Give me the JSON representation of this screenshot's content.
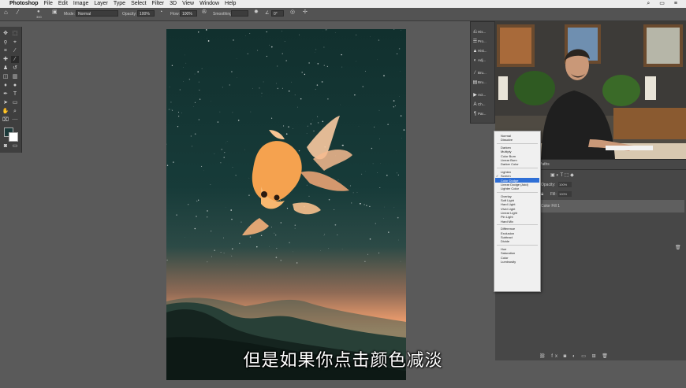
{
  "menubar": {
    "app_name": "Photoshop",
    "items": [
      "File",
      "Edit",
      "Image",
      "Layer",
      "Type",
      "Select",
      "Filter",
      "3D",
      "View",
      "Window",
      "Help"
    ]
  },
  "options_bar": {
    "brush_size": "300",
    "mode_label": "Mode:",
    "mode_value": "Normal",
    "opacity_label": "Opacity:",
    "opacity_value": "100%",
    "flow_label": "Flow:",
    "flow_value": "100%",
    "smoothing_label": "Smoothing:",
    "angle_value": "0°"
  },
  "mini_panels": [
    {
      "label": "His...",
      "icon": "history-icon"
    },
    {
      "label": "Pro...",
      "icon": "properties-icon"
    },
    {
      "label": "Hist...",
      "icon": "histogram-icon"
    },
    {
      "label": "Adj...",
      "icon": "adjustments-icon"
    },
    {
      "label": "Bru...",
      "icon": "brush-icon"
    },
    {
      "label": "Bru...",
      "icon": "brush-settings-icon"
    },
    {
      "label": "Act...",
      "icon": "actions-icon"
    },
    {
      "label": "Ch...",
      "icon": "character-icon"
    },
    {
      "label": "Par...",
      "icon": "paragraph-icon"
    }
  ],
  "layers_panel": {
    "tab_paths": "Paths",
    "opacity_label": "Opacity:",
    "opacity_value": "100%",
    "fill_label": "Fill:",
    "fill_value": "100%",
    "layer_name": "Color Fill 1"
  },
  "blend_dropdown": {
    "selected": "Screen",
    "highlighted": "Color Dodge",
    "groups": [
      [
        "Normal",
        "Dissolve"
      ],
      [
        "Darken",
        "Multiply",
        "Color Burn",
        "Linear Burn",
        "Darker Color"
      ],
      [
        "Lighten",
        "Screen",
        "Color Dodge",
        "Linear Dodge (Add)",
        "Lighter Color"
      ],
      [
        "Overlay",
        "Soft Light",
        "Hard Light",
        "Vivid Light",
        "Linear Light",
        "Pin Light",
        "Hard Mix"
      ],
      [
        "Difference",
        "Exclusion",
        "Subtract",
        "Divide"
      ],
      [
        "Hue",
        "Saturation",
        "Color",
        "Luminosity"
      ]
    ]
  },
  "subtitle": "但是如果你点击颜色减淡",
  "colors": {
    "ui_dark": "#535353",
    "sky_top": "#11302e",
    "horizon": "#f3b27e",
    "highlight": "#2f6fd6"
  }
}
